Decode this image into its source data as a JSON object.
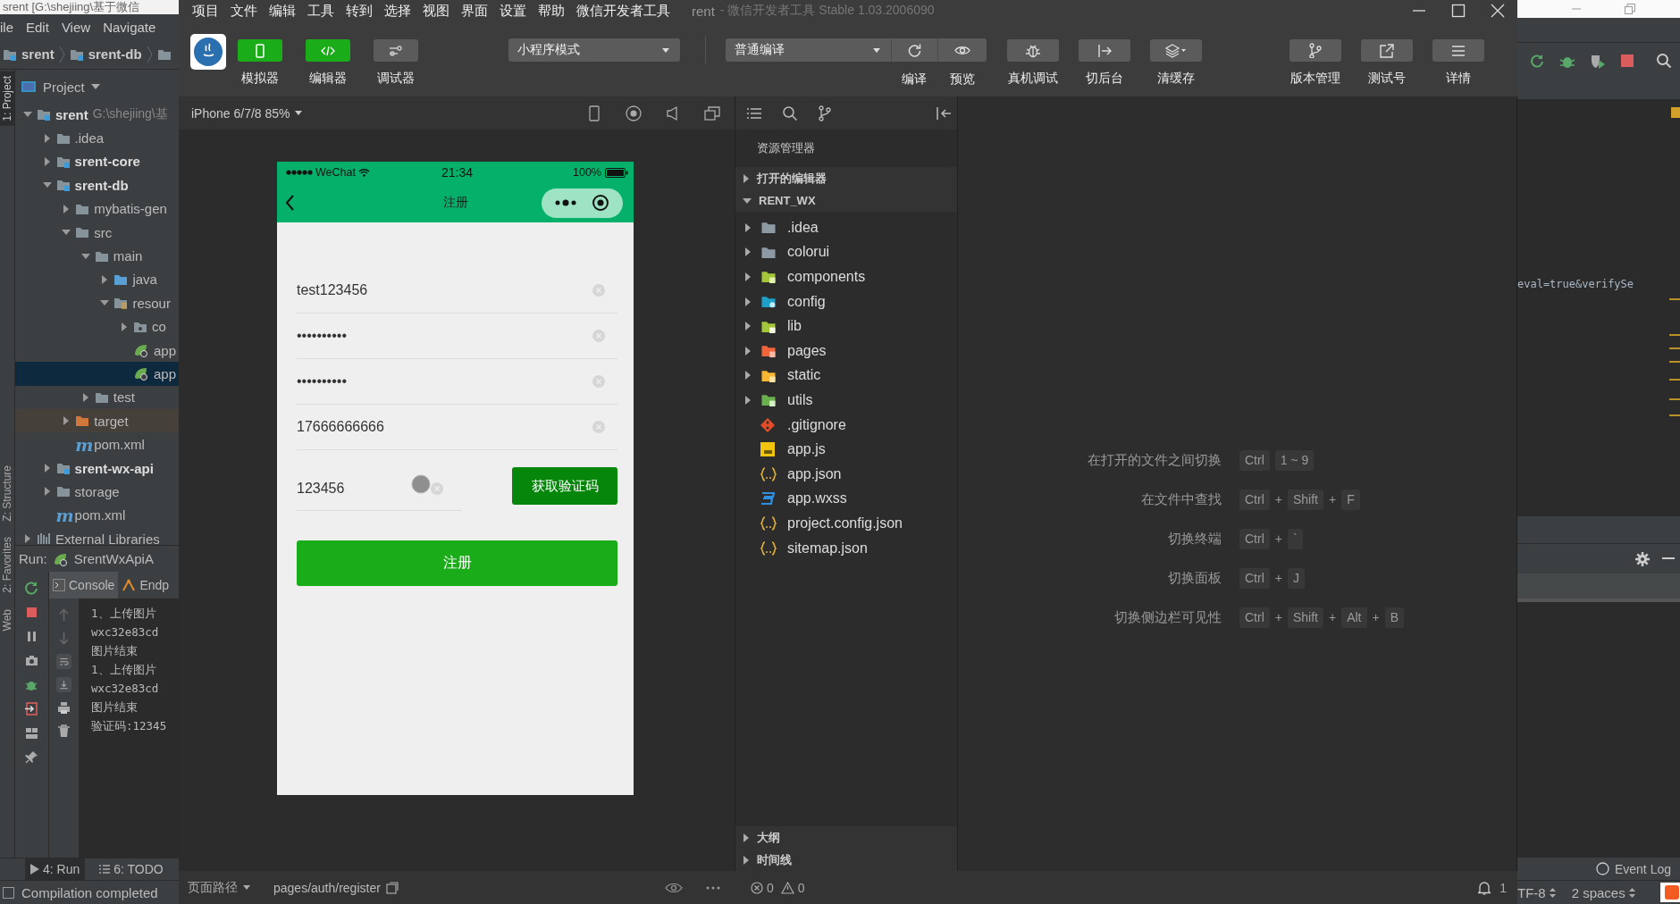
{
  "ide_left": {
    "window_title": "srent [G:\\shejiing\\基于微信",
    "menu": [
      "ile",
      "Edit",
      "View",
      "Navigate"
    ],
    "breadcrumb": [
      "srent",
      "srent-db"
    ],
    "side_tabs": [
      {
        "label": "1: Project",
        "selected": true
      },
      {
        "label": "Z: Structure",
        "selected": false
      },
      {
        "label": "2: Favorites",
        "selected": false
      },
      {
        "label": "Web",
        "selected": false
      }
    ],
    "project_panel": {
      "title": "Project",
      "tree": [
        {
          "label": "srent",
          "detail": "G:\\shejiing\\基",
          "kind": "module",
          "selected": false,
          "expanded": true,
          "children": [
            {
              "label": ".idea",
              "kind": "folder",
              "selected": false,
              "expanded": false
            },
            {
              "label": "srent-core",
              "kind": "module",
              "selected": false,
              "expanded": false
            },
            {
              "label": "srent-db",
              "kind": "module",
              "selected": false,
              "expanded": true,
              "children": [
                {
                  "label": "mybatis-gen",
                  "kind": "folder",
                  "selected": false,
                  "expanded": false
                },
                {
                  "label": "src",
                  "kind": "folder",
                  "selected": false,
                  "expanded": true,
                  "children": [
                    {
                      "label": "main",
                      "kind": "folder",
                      "selected": false,
                      "expanded": true,
                      "children": [
                        {
                          "label": "java",
                          "kind": "source",
                          "selected": false,
                          "expanded": false
                        },
                        {
                          "label": "resour",
                          "kind": "resources",
                          "selected": false,
                          "expanded": true,
                          "children": [
                            {
                              "label": "co",
                              "kind": "package",
                              "selected": false,
                              "expanded": false
                            },
                            {
                              "label": "app",
                              "kind": "spring",
                              "selected": false
                            },
                            {
                              "label": "app",
                              "kind": "spring",
                              "selected": true
                            }
                          ]
                        }
                      ]
                    },
                    {
                      "label": "test",
                      "kind": "folder",
                      "selected": false,
                      "expanded": false
                    }
                  ]
                },
                {
                  "label": "target",
                  "kind": "excluded",
                  "selected": false,
                  "expanded": false
                },
                {
                  "label": "pom.xml",
                  "kind": "maven",
                  "icon_text": "m",
                  "selected": false
                }
              ]
            },
            {
              "label": "srent-wx-api",
              "kind": "module",
              "selected": false,
              "expanded": false
            },
            {
              "label": "storage",
              "kind": "folder",
              "selected": false,
              "expanded": false
            },
            {
              "label": "pom.xml",
              "kind": "maven",
              "icon_text": "m",
              "selected": false
            }
          ]
        },
        {
          "label": "External Libraries",
          "kind": "libraries",
          "selected": false,
          "expanded": false
        }
      ]
    },
    "run_panel": {
      "label": "Run:",
      "config": "SrentWxApiA",
      "tabs": [
        {
          "label": "Console",
          "selected": true
        },
        {
          "label": "Endp",
          "selected": false
        }
      ],
      "console": [
        "1、上传图片",
        "wxc32e83cd",
        "图片结束",
        "1、上传图片",
        "wxc32e83cd",
        "图片结束",
        "验证码:12345"
      ]
    },
    "bottom_tabs": [
      {
        "label": "4: Run",
        "selected": true
      },
      {
        "label": "6: TODO",
        "selected": false
      }
    ],
    "status": "Compilation completed"
  },
  "devtools": {
    "menu": [
      "项目",
      "文件",
      "编辑",
      "工具",
      "转到",
      "选择",
      "视图",
      "界面",
      "设置",
      "帮助",
      "微信开发者工具"
    ],
    "title": "rent",
    "subtitle": "- 微信开发者工具 Stable 1.03.2006090",
    "toolbar": {
      "view_toggles": [
        {
          "label": "模拟器",
          "on": true
        },
        {
          "label": "编辑器",
          "on": true
        },
        {
          "label": "调试器",
          "on": false
        }
      ],
      "mode": "小程序模式",
      "compile_mode": "普通编译",
      "compile_actions": [
        {
          "label": "编译",
          "kind": "refresh"
        },
        {
          "label": "预览",
          "kind": "eye"
        }
      ],
      "debug_actions": [
        {
          "label": "真机调试",
          "kind": "bug"
        },
        {
          "label": "切后台",
          "kind": "exit"
        },
        {
          "label": "清缓存",
          "kind": "layers"
        }
      ],
      "project_actions": [
        {
          "label": "版本管理",
          "kind": "branch"
        },
        {
          "label": "测试号",
          "kind": "share"
        },
        {
          "label": "详情",
          "kind": "menu"
        }
      ]
    },
    "simulator": {
      "device": "iPhone 6/7/8 85%",
      "phone": {
        "carrier": "WeChat",
        "time": "21:34",
        "battery": "100%",
        "title": "注册",
        "fields": [
          {
            "value": "test123456"
          },
          {
            "value": "••••••••••"
          },
          {
            "value": "••••••••••"
          },
          {
            "value": "17666666666"
          }
        ],
        "code_field": {
          "value": "123456"
        },
        "code_button": "获取验证码",
        "submit": "注册"
      }
    },
    "explorer": {
      "title": "资源管理器",
      "sections": [
        {
          "label": "打开的编辑器",
          "expanded": false
        },
        {
          "label": "RENT_WX",
          "expanded": true
        }
      ],
      "files": [
        {
          "label": ".idea",
          "kind": "folder",
          "expanded": false
        },
        {
          "label": "colorui",
          "kind": "folder",
          "expanded": false
        },
        {
          "label": "components",
          "kind": "components",
          "expanded": false
        },
        {
          "label": "config",
          "kind": "config",
          "expanded": false
        },
        {
          "label": "lib",
          "kind": "lib",
          "expanded": false
        },
        {
          "label": "pages",
          "kind": "pages",
          "expanded": false
        },
        {
          "label": "static",
          "kind": "static",
          "expanded": false
        },
        {
          "label": "utils",
          "kind": "utils",
          "expanded": false
        },
        {
          "label": ".gitignore",
          "kind": "git"
        },
        {
          "label": "app.js",
          "kind": "js"
        },
        {
          "label": "app.json",
          "kind": "json"
        },
        {
          "label": "app.wxss",
          "kind": "css"
        },
        {
          "label": "project.config.json",
          "kind": "json"
        },
        {
          "label": "sitemap.json",
          "kind": "json"
        }
      ],
      "bottom_sections": [
        {
          "label": "大纲",
          "expanded": false
        },
        {
          "label": "时间线",
          "expanded": false
        }
      ]
    },
    "editor": {
      "shortcuts": [
        {
          "label": "在打开的文件之间切换",
          "keys": [
            {
              "kind": "key",
              "text": "Ctrl"
            },
            {
              "kind": "key",
              "text": "1 ~ 9"
            }
          ]
        },
        {
          "label": "在文件中查找",
          "keys": [
            {
              "kind": "key",
              "text": "Ctrl"
            },
            {
              "kind": "plus",
              "text": "+"
            },
            {
              "kind": "key",
              "text": "Shift"
            },
            {
              "kind": "plus",
              "text": "+"
            },
            {
              "kind": "key",
              "text": "F"
            }
          ]
        },
        {
          "label": "切换终端",
          "keys": [
            {
              "kind": "key",
              "text": "Ctrl"
            },
            {
              "kind": "plus",
              "text": "+"
            },
            {
              "kind": "key",
              "text": "`"
            }
          ]
        },
        {
          "label": "切换面板",
          "keys": [
            {
              "kind": "key",
              "text": "Ctrl"
            },
            {
              "kind": "plus",
              "text": "+"
            },
            {
              "kind": "key",
              "text": "J"
            }
          ]
        },
        {
          "label": "切换侧边栏可见性",
          "keys": [
            {
              "kind": "key",
              "text": "Ctrl"
            },
            {
              "kind": "plus",
              "text": "+"
            },
            {
              "kind": "key",
              "text": "Shift"
            },
            {
              "kind": "plus",
              "text": "+"
            },
            {
              "kind": "key",
              "text": "Alt"
            },
            {
              "kind": "plus",
              "text": "+"
            },
            {
              "kind": "key",
              "text": "B"
            }
          ]
        }
      ]
    },
    "status_bar": {
      "path_label": "页面路径",
      "path": "pages/auth/register",
      "errors": "0",
      "warnings": "0",
      "notifications": "1"
    }
  },
  "ide_right": {
    "code_line": "eval=true&verifySe",
    "event_log": "Event Log",
    "encoding": "TF-8",
    "indent": "2 spaces"
  }
}
